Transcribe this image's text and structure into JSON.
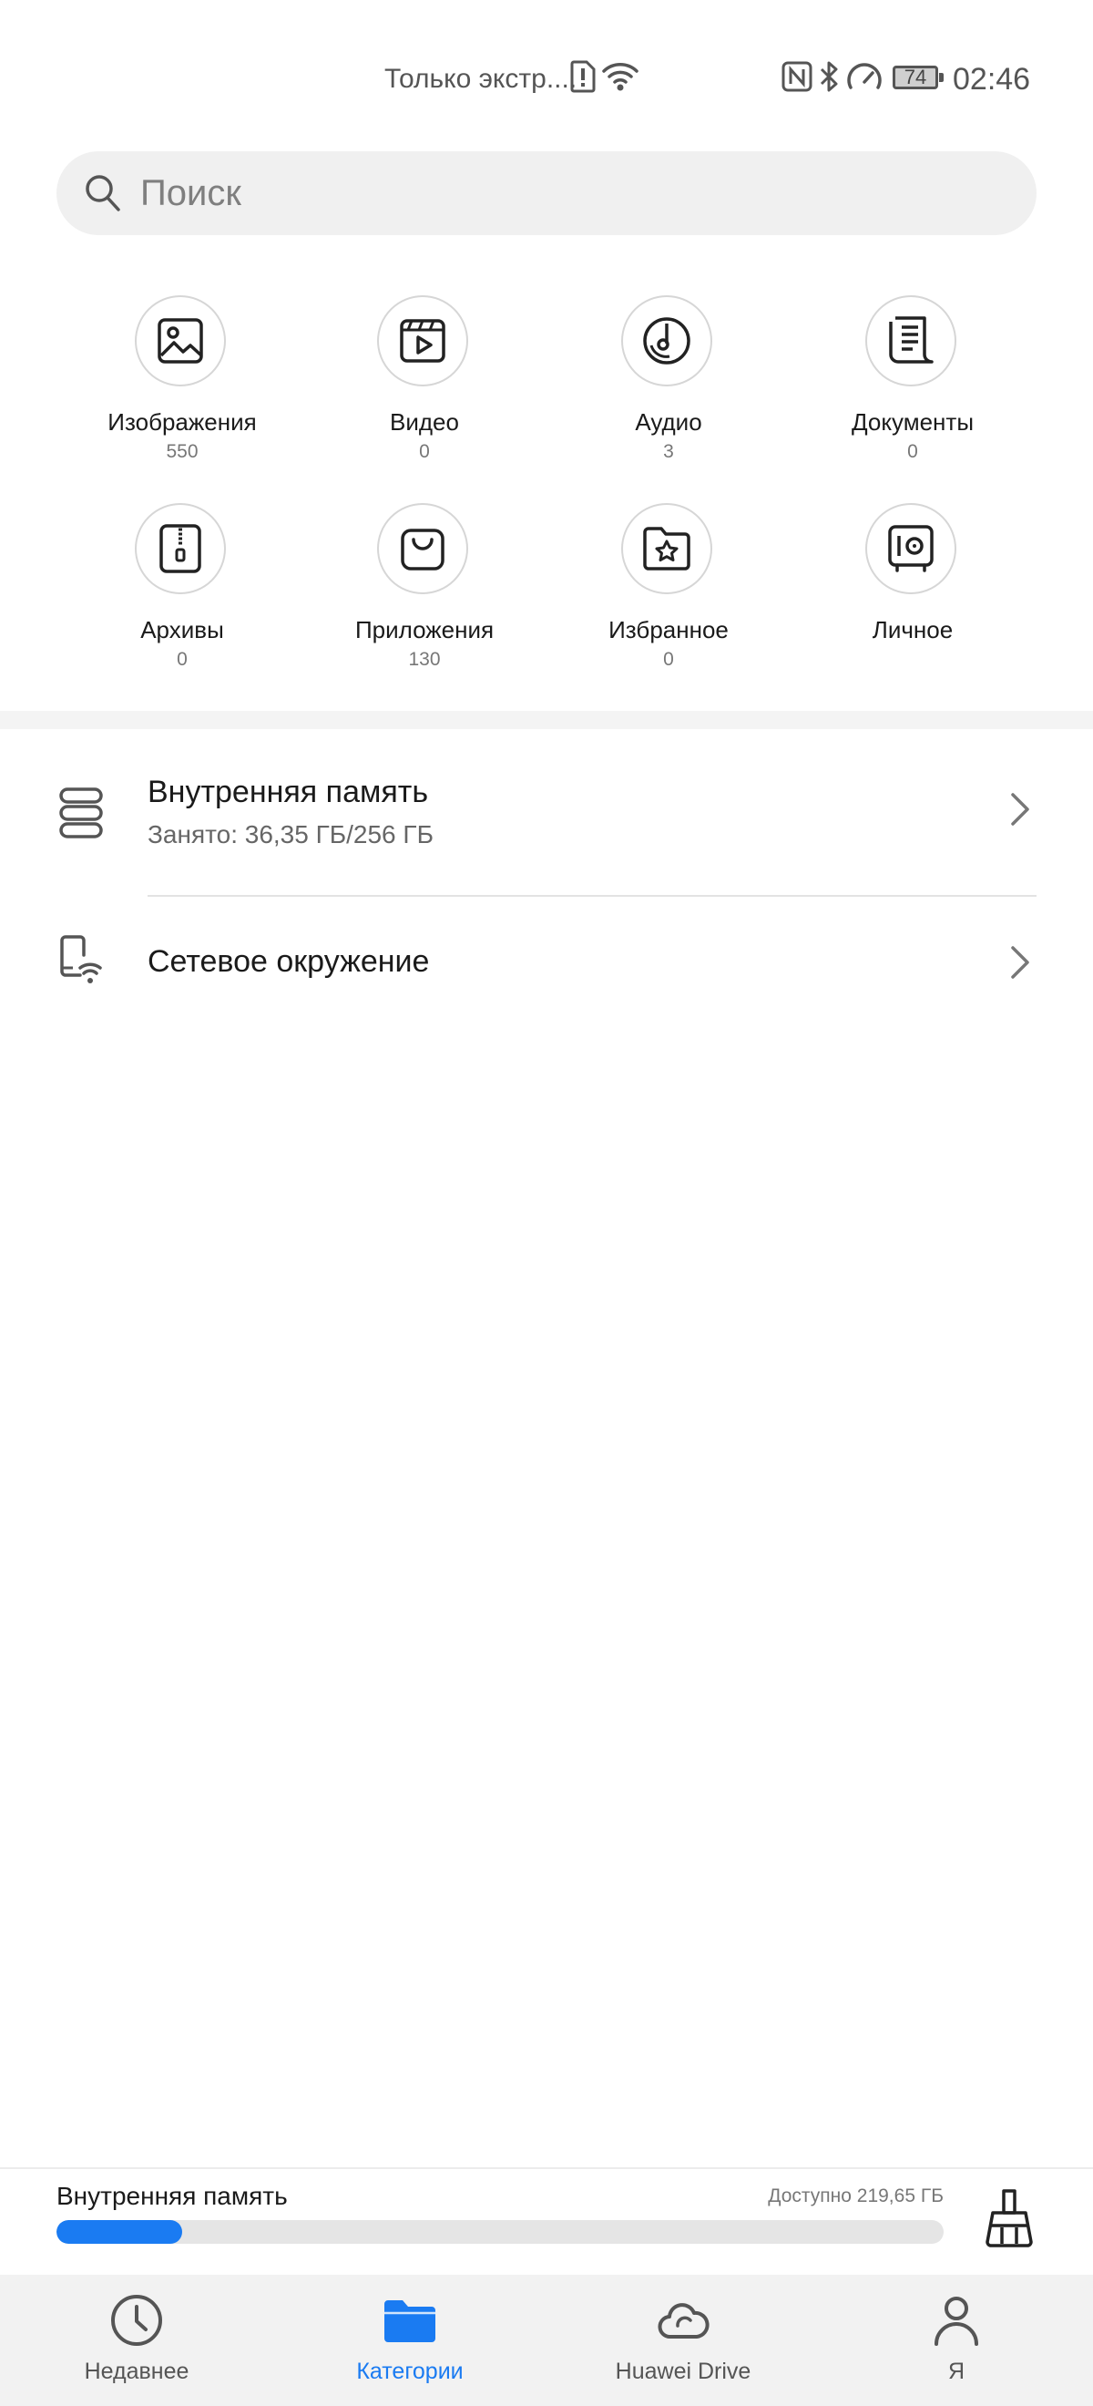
{
  "status_bar": {
    "carrier": "Только экстр....",
    "battery": "74",
    "time": "02:46"
  },
  "search": {
    "placeholder": "Поиск"
  },
  "categories": [
    {
      "label": "Изображения",
      "count": "550",
      "icon": "image-icon"
    },
    {
      "label": "Видео",
      "count": "0",
      "icon": "video-icon"
    },
    {
      "label": "Аудио",
      "count": "3",
      "icon": "audio-icon"
    },
    {
      "label": "Документы",
      "count": "0",
      "icon": "document-icon"
    },
    {
      "label": "Архивы",
      "count": "0",
      "icon": "archive-icon"
    },
    {
      "label": "Приложения",
      "count": "130",
      "icon": "app-bag-icon"
    },
    {
      "label": "Избранное",
      "count": "0",
      "icon": "favorites-icon"
    },
    {
      "label": "Личное",
      "count": "",
      "icon": "safe-icon"
    }
  ],
  "storage_rows": [
    {
      "title": "Внутренняя память",
      "subtitle": "Занято: 36,35 ГБ/256 ГБ"
    },
    {
      "title": "Сетевое окружение"
    }
  ],
  "bottom_storage": {
    "label": "Внутренняя память",
    "available": "Доступно 219,65 ГБ",
    "used_fraction": 0.142
  },
  "nav": [
    {
      "label": "Недавнее",
      "icon": "clock-icon",
      "active": false
    },
    {
      "label": "Категории",
      "icon": "folder-icon",
      "active": true
    },
    {
      "label": "Huawei Drive",
      "icon": "cloud-icon",
      "active": false
    },
    {
      "label": "Я",
      "icon": "person-icon",
      "active": false
    }
  ],
  "colors": {
    "accent": "#1a7bf2",
    "icon_gray": "#555555"
  }
}
